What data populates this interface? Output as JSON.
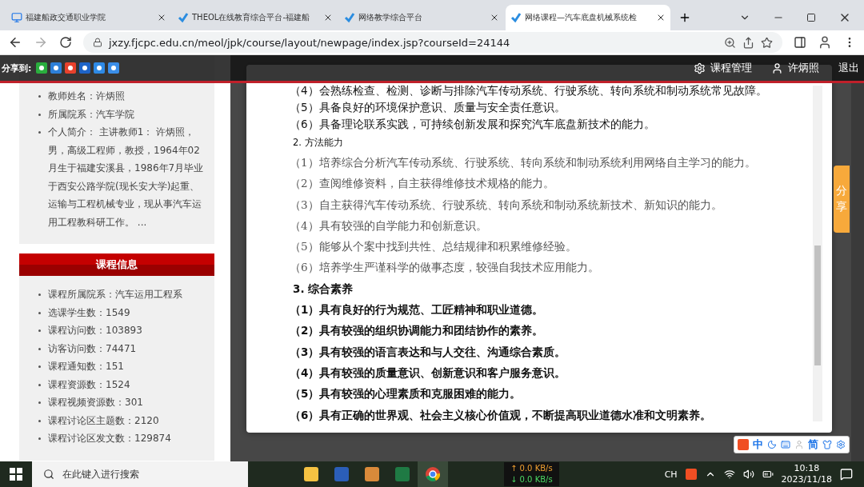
{
  "browser": {
    "tabs": [
      {
        "title": "福建船政交通职业学院",
        "selected": false
      },
      {
        "title": "THEOL在线教育综合平台-福建船",
        "selected": false
      },
      {
        "title": "网络教学综合平台",
        "selected": false
      },
      {
        "title": "网络课程—汽车底盘机械系统检",
        "selected": true
      }
    ],
    "url": "jxzy.fjcpc.edu.cn/meol/jpk/course/layout/newpage/index.jsp?courseId=24144"
  },
  "share_bar": {
    "label": "分享到:",
    "course_manage": "课程管理",
    "user": "许炳照",
    "logout": "退出"
  },
  "teacher_info": {
    "items": [
      "教师姓名：许炳照",
      "所属院系：汽车学院",
      "个人简介： 主讲教师1： 许炳照，男，高级工程师，教授，1964年02月生于福建安溪县，1986年7月毕业于西安公路学院(现长安大学)起重、运输与工程机械专业，现从事汽车运用工程教科研工作。 ..."
    ]
  },
  "course_info": {
    "title": "课程信息",
    "items": [
      "课程所属院系：汽车运用工程系",
      "选课学生数：1549",
      "课程访问数：103893",
      "访客访问数：74471",
      "课程通知数：151",
      "课程资源数：1524",
      "课程视频资源数：301",
      "课程讨论区主题数：2120",
      "课程讨论区发文数：129874"
    ]
  },
  "modal": {
    "lines": [
      {
        "kind": "item",
        "text": "（4）会熟练检查、检测、诊断与排除汽车传动系统、行驶系统、转向系统和制动系统常见故障。"
      },
      {
        "kind": "item",
        "text": "（5）具备良好的环境保护意识、质量与安全责任意识。"
      },
      {
        "kind": "item",
        "text": "（6）具备理论联系实践，可持续创新发展和探究汽车底盘新技术的能力。"
      },
      {
        "kind": "subheading",
        "text": "2. 方法能力"
      },
      {
        "kind": "muted",
        "text": "（1）培养综合分析汽车传动系统、行驶系统、转向系统和制动系统利用网络自主学习的能力。"
      },
      {
        "kind": "muted",
        "text": "（2）查阅维修资料，自主获得维修技术规格的能力。"
      },
      {
        "kind": "muted",
        "text": "（3）自主获得汽车传动系统、行驶系统、转向系统和制动系统新技术、新知识的能力。"
      },
      {
        "kind": "muted",
        "text": "（4）具有较强的自学能力和创新意识。"
      },
      {
        "kind": "muted",
        "text": "（5）能够从个案中找到共性、总结规律和积累维修经验。"
      },
      {
        "kind": "muted",
        "text": "（6）培养学生严谨科学的做事态度，较强自我技术应用能力。"
      },
      {
        "kind": "heading",
        "text": "3. 综合素养"
      },
      {
        "kind": "strong",
        "text": "（1）具有良好的行为规范、工匠精神和职业道德。"
      },
      {
        "kind": "strong",
        "text": "（2）具有较强的组织协调能力和团结协作的素养。"
      },
      {
        "kind": "strong",
        "text": "（3）具有较强的语言表达和与人交往、沟通综合素质。"
      },
      {
        "kind": "strong",
        "text": "（4）具有较强的质量意识、创新意识和客户服务意识。"
      },
      {
        "kind": "strong",
        "text": "（5）具有较强的心理素质和克服困难的能力。"
      },
      {
        "kind": "strong",
        "text": "（6）具有正确的世界观、社会主义核心价值观，不断提高职业道德水准和文明素养。"
      }
    ]
  },
  "side_tab": {
    "label": "分享"
  },
  "ime": {
    "mode": "中",
    "script": "简"
  },
  "taskbar": {
    "search_placeholder": "在此键入进行搜索",
    "net_up": "↑ 0.0 KB/s",
    "net_down": "↓ 0.0 KB/s",
    "lang": "CH",
    "time": "10:18",
    "date": "2023/11/18"
  }
}
